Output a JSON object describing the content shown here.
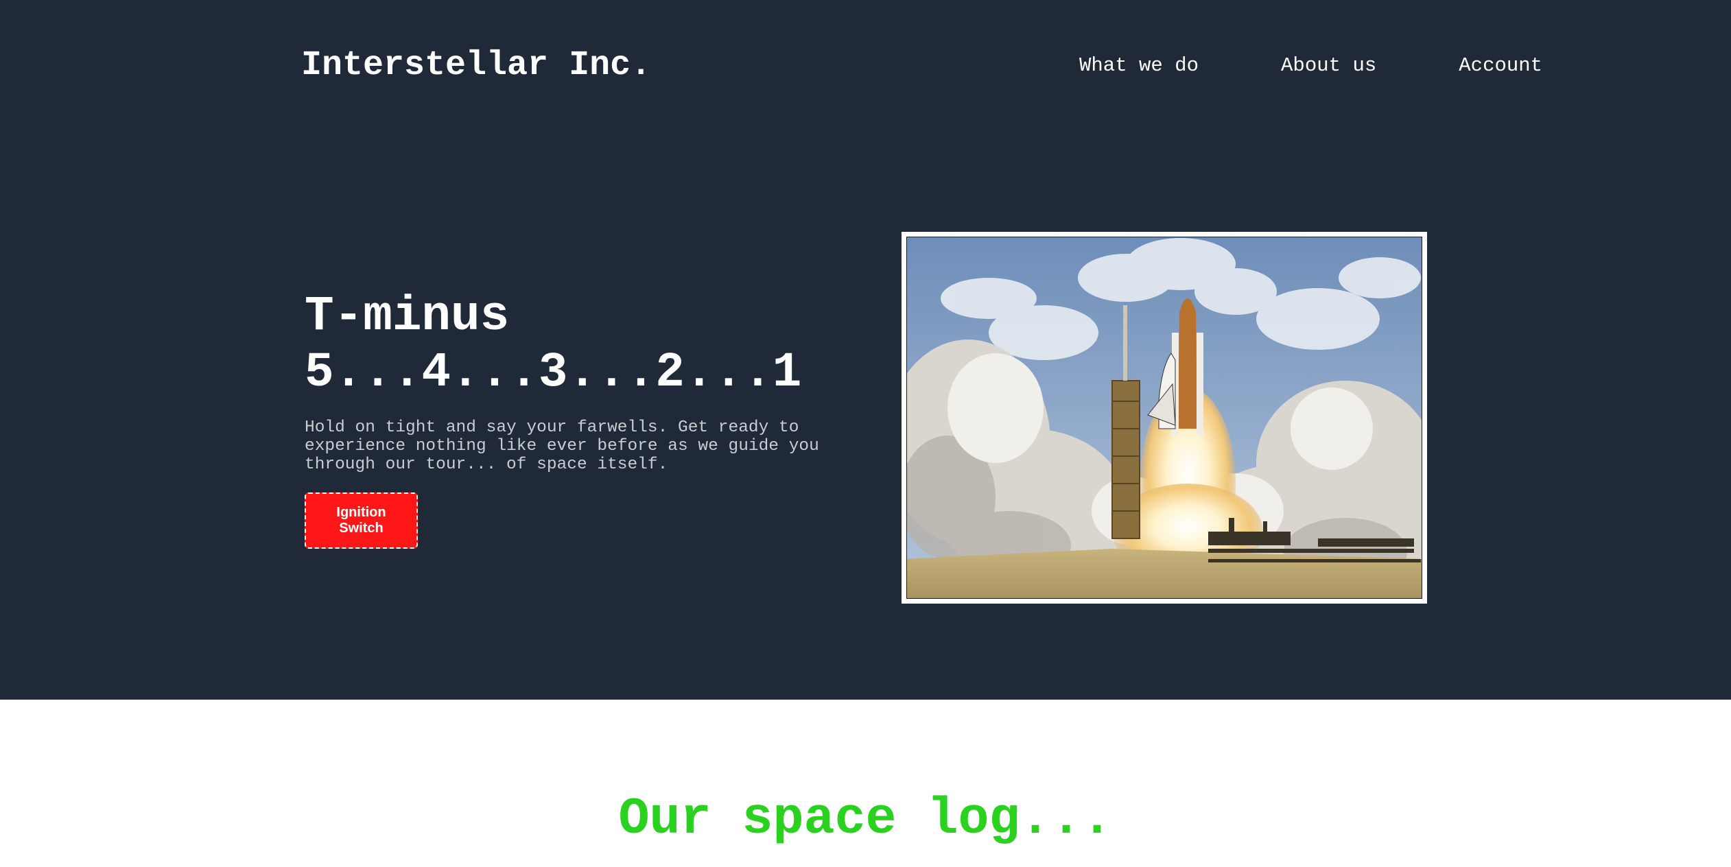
{
  "header": {
    "logo": "Interstellar Inc.",
    "nav": [
      {
        "label": "What we do"
      },
      {
        "label": "About us"
      },
      {
        "label": "Account"
      }
    ]
  },
  "hero": {
    "headline": "T-minus 5...4...3...2...1",
    "tagline": "Hold on tight and say your farwells. Get ready to experience nothing like ever before as we guide you through our tour... of space itself.",
    "cta_label": "Ignition Switch",
    "image_subject": "space shuttle launch with exhaust clouds"
  },
  "log_section": {
    "title": "Our space log..."
  },
  "colors": {
    "hero_background": "#202938",
    "cta_background": "#ff1717",
    "section_title": "#2bd11f",
    "tagline_text": "#c9ccd2"
  }
}
